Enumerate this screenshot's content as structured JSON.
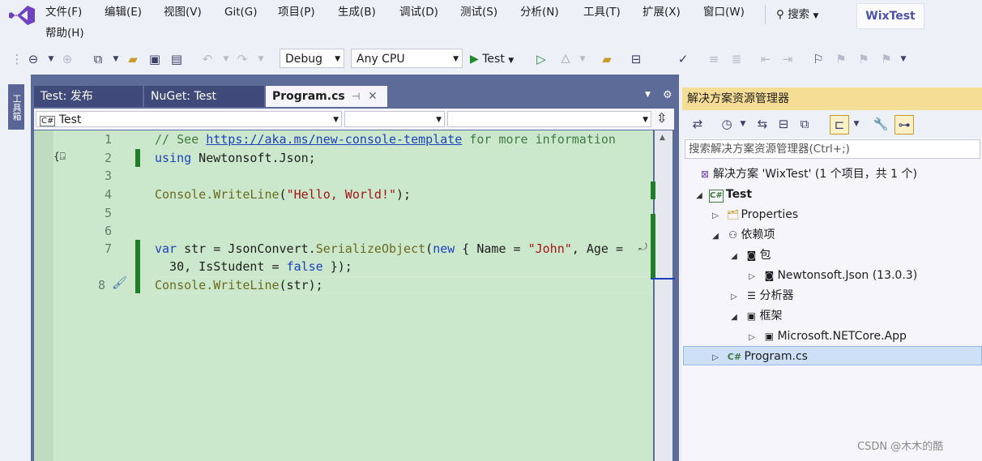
{
  "menu": {
    "items": [
      "文件(F)",
      "编辑(E)",
      "视图(V)",
      "Git(G)",
      "项目(P)",
      "生成(B)",
      "调试(D)",
      "测试(S)",
      "分析(N)",
      "工具(T)",
      "扩展(X)",
      "窗口(W)",
      "帮助(H)"
    ],
    "search_label": "搜索",
    "solution_name": "WixTest"
  },
  "toolbar": {
    "config": "Debug",
    "platform": "Any CPU",
    "run_label": "Test"
  },
  "left_rail": {
    "toolbox_label": "工具箱"
  },
  "doc_tabs": [
    {
      "label": "Test: 发布"
    },
    {
      "label": "NuGet: Test"
    },
    {
      "label": "Program.cs"
    }
  ],
  "nav_bar": {
    "project": "Test",
    "project_badge": "C#"
  },
  "code": {
    "line_numbers": [
      "1",
      "2",
      "3",
      "4",
      "5",
      "6",
      "7",
      "",
      "8"
    ],
    "line1_prefix": "// See ",
    "line1_link": "https://aka.ms/new-console-template",
    "line1_suffix": " for more information",
    "line2_kw": "using",
    "line2_rest": " Newtonsoft.Json;",
    "line4_a": "Console.",
    "line4_m": "WriteLine",
    "line4_b": "(",
    "line4_s": "\"Hello, World!\"",
    "line4_c": ");",
    "line7_kw": "var",
    "line7_a": " str = JsonConvert.",
    "line7_m": "SerializeObject",
    "line7_b": "(",
    "line7_kw2": "new",
    "line7_c": " { Name = ",
    "line7_s": "\"John\"",
    "line7_d": ", Age = ",
    "line7b_a": "  30, IsStudent = ",
    "line7b_kw": "false",
    "line7b_b": " });",
    "line8_a": "Console.",
    "line8_m": "WriteLine",
    "line8_b": "(str);"
  },
  "solution_explorer": {
    "title": "解决方案资源管理器",
    "search_placeholder": "搜索解决方案资源管理器(Ctrl+;)",
    "tree": [
      {
        "label": "解决方案 'WixTest' (1 个项目，共 1 个)"
      },
      {
        "label": "Test"
      },
      {
        "label": "Properties"
      },
      {
        "label": "依赖项"
      },
      {
        "label": "包"
      },
      {
        "label": "Newtonsoft.Json (13.0.3)"
      },
      {
        "label": "分析器"
      },
      {
        "label": "框架"
      },
      {
        "label": "Microsoft.NETCore.App"
      },
      {
        "label": "Program.cs"
      }
    ],
    "cs_badge": "C#"
  },
  "watermark": "CSDN @木木的酷"
}
